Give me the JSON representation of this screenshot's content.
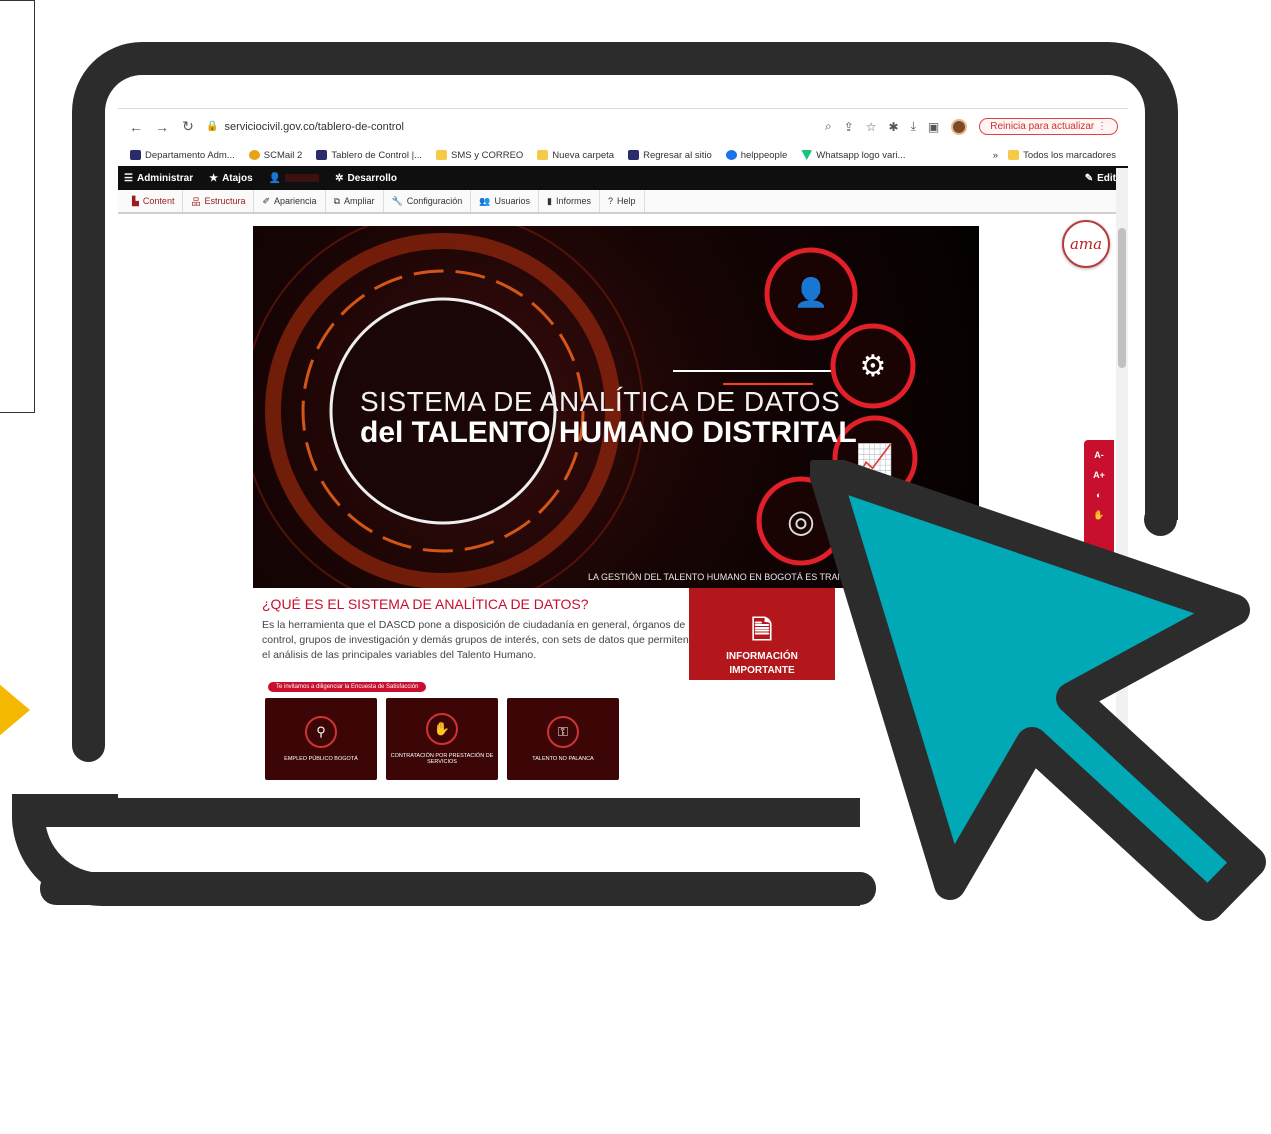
{
  "browser": {
    "url": "serviciocivil.gov.co/tablero-de-control",
    "update_label": "Reinicia para actualizar",
    "bookmarks": [
      {
        "label": "Departamento Adm...",
        "color": "#2b2b6b"
      },
      {
        "label": "SCMail 2",
        "color": "#e8a317"
      },
      {
        "label": "Tablero de Control |...",
        "color": "#2b2b6b"
      },
      {
        "label": "SMS y CORREO",
        "color": "#f7c948"
      },
      {
        "label": "Nueva carpeta",
        "color": "#f7c948"
      },
      {
        "label": "Regresar al sitio",
        "color": "#2b2b6b"
      },
      {
        "label": "helppeople",
        "color": "#1a73e8"
      },
      {
        "label": "Whatsapp logo vari...",
        "color": "#19c37d"
      }
    ],
    "more_bookmarks": "»",
    "all_bookmarks": "Todos los marcadores"
  },
  "admin_bar": {
    "administrar": "Administrar",
    "atajos": "Atajos",
    "desarrollo": "Desarrollo",
    "edit": "Edit"
  },
  "toolbar": {
    "items": [
      "Content",
      "Estructura",
      "Apariencia",
      "Ampliar",
      "Configuración",
      "Usuarios",
      "Informes",
      "Help"
    ]
  },
  "hero": {
    "title_line1": "SISTEMA DE ANALÍTICA DE DATOS",
    "title_line2": "del TALENTO HUMANO DISTRITAL",
    "caption": "LA GESTIÓN DEL TALENTO HUMANO EN BOGOTÁ ES TRANSPARE"
  },
  "info": {
    "title": "¿QUÉ ES EL SISTEMA DE ANALÍTICA DE DATOS?",
    "text": "Es la herramienta que el DASCD pone a disposición de ciudadanía en general, órganos de control, grupos de investigación y demás grupos de interés, con sets de datos que permiten el análisis de las principales variables del Talento Humano."
  },
  "important_card": {
    "line1": "INFORMACIÓN",
    "line2": "IMPORTANTE"
  },
  "survey_label": "Te invitamos a diligenciar la Encuesta de Satisfacción",
  "tiles": [
    {
      "label": "EMPLEO PÚBLICO BOGOTÁ"
    },
    {
      "label": "CONTRATACIÓN POR PRESTACIÓN DE SERVICIOS"
    },
    {
      "label": "TALENTO NO PALANCA"
    }
  ],
  "accessibility": {
    "decrease": "A-",
    "increase": "A+"
  },
  "badge_text": "ama",
  "colors": {
    "brand_red": "#c8102e",
    "laptop_frame": "#2c2c2c",
    "cursor_fill": "#00a9b5",
    "accent_yellow": "#f5b800"
  }
}
